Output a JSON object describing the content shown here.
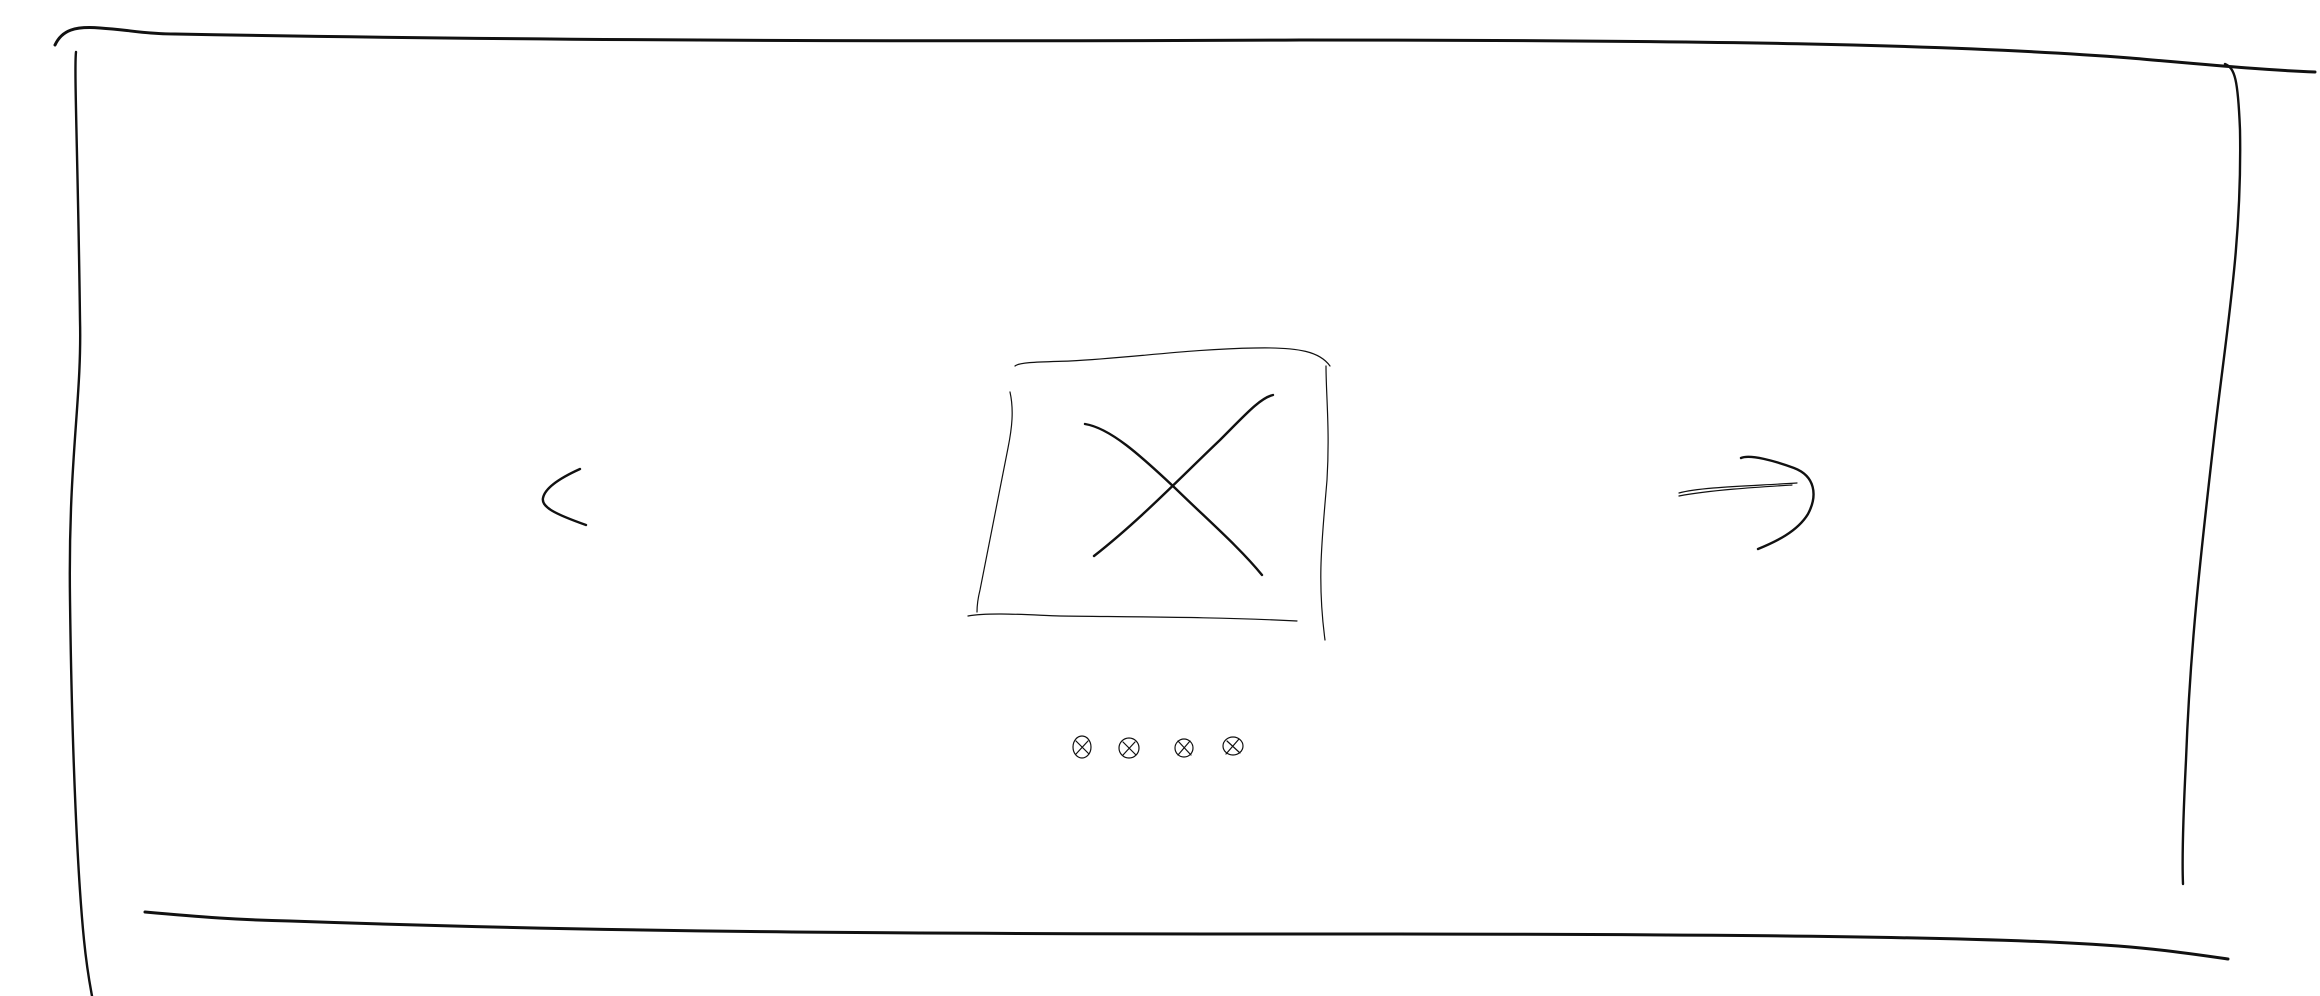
{
  "carousel": {
    "slide_image": {
      "icon": "image-placeholder-icon"
    },
    "prev_control": {
      "icon": "chevron-left-icon"
    },
    "next_control": {
      "icon": "arrow-right-icon"
    },
    "indicators": [
      {
        "icon": "dot-placeholder-icon"
      },
      {
        "icon": "dot-placeholder-icon"
      },
      {
        "icon": "dot-placeholder-icon"
      },
      {
        "icon": "dot-placeholder-icon"
      }
    ]
  },
  "colors": {
    "stroke": "#111111",
    "background": "#ffffff"
  }
}
